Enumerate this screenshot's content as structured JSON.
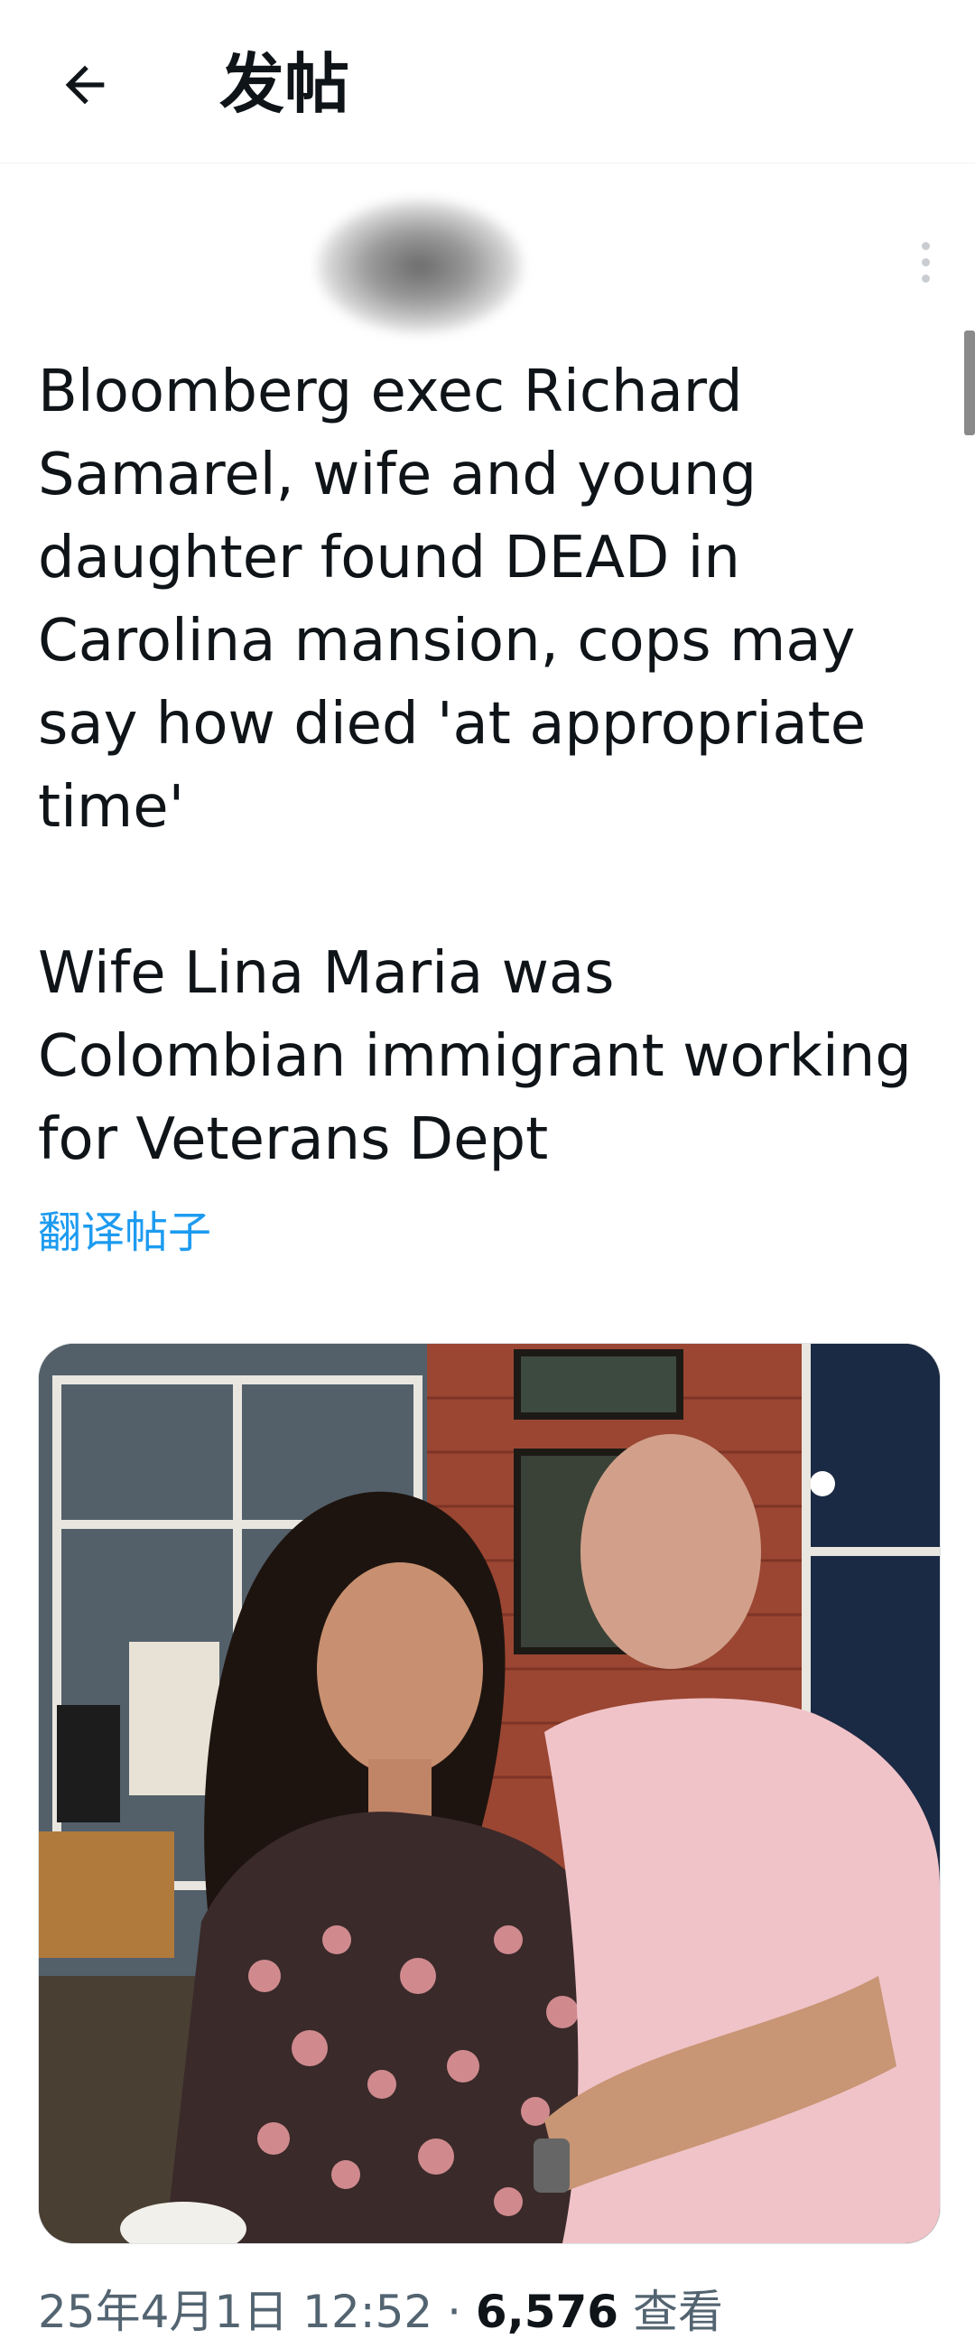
{
  "header": {
    "title": "发帖",
    "back_icon": "arrow-left-icon"
  },
  "post": {
    "more_icon": "more-vertical-icon",
    "text": "Bloomberg exec Richard Samarel, wife and young daughter found DEAD in Carolina mansion, cops may say how died 'at appropriate time'\n\nWife Lina Maria was Colombian immigrant working for Veterans Dept",
    "translate_label": "翻译帖子",
    "timestamp": "25年4月1日 12:52",
    "separator": " · ",
    "views_count": "6,576",
    "views_label": " 查看"
  },
  "colors": {
    "link": "#1d9bf0",
    "text": "#0f1419",
    "secondary": "#536471"
  }
}
